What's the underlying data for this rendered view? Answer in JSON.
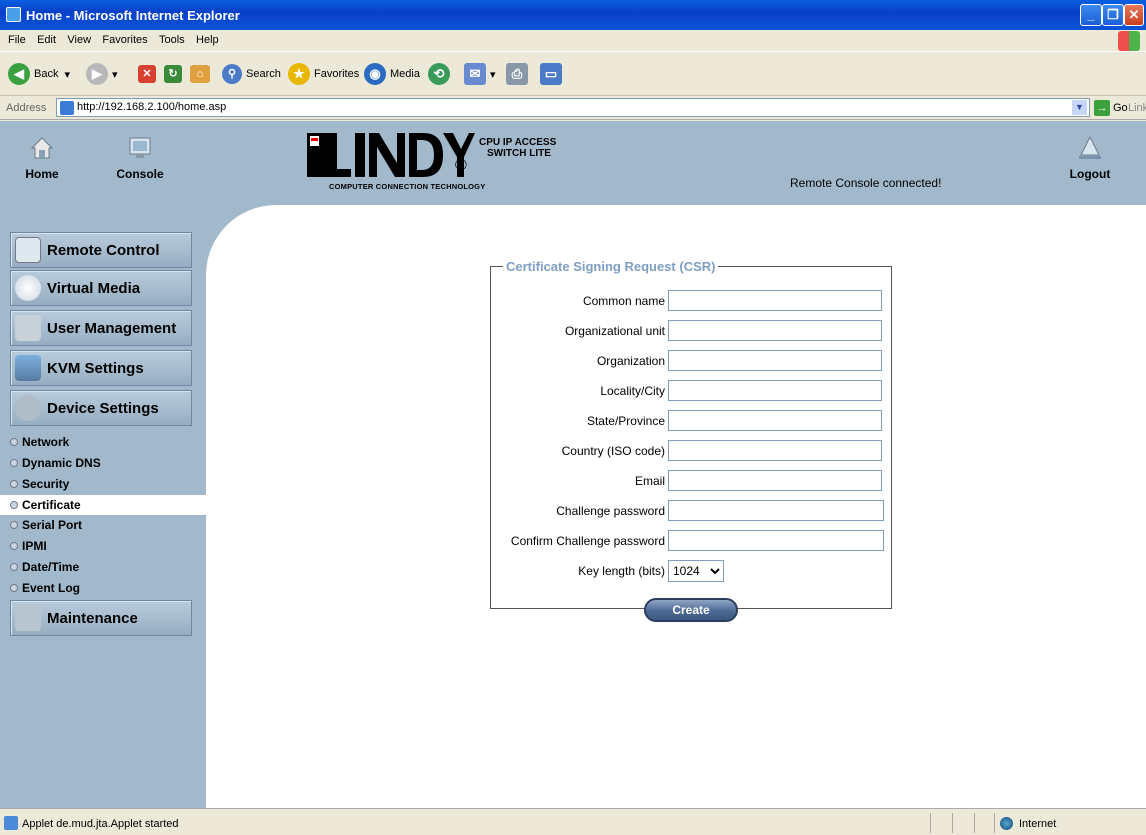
{
  "window": {
    "title": "Home - Microsoft Internet Explorer"
  },
  "menubar": [
    "File",
    "Edit",
    "View",
    "Favorites",
    "Tools",
    "Help"
  ],
  "toolbar": {
    "back": "Back",
    "search": "Search",
    "favorites": "Favorites",
    "media": "Media"
  },
  "address": {
    "label": "Address",
    "url": "http://192.168.2.100/home.asp",
    "go": "Go",
    "links": "Links"
  },
  "header": {
    "home": "Home",
    "console": "Console",
    "logo_text": "LINDY",
    "logo_sub": "COMPUTER CONNECTION TECHNOLOGY",
    "product_line1": "CPU IP ACCESS",
    "product_line2": "SWITCH LITE",
    "status": "Remote Console connected!",
    "logout": "Logout"
  },
  "sidebar": {
    "menus": [
      "Remote Control",
      "Virtual Media",
      "User Management",
      "KVM Settings",
      "Device Settings",
      "Maintenance"
    ],
    "submenu": [
      "Network",
      "Dynamic DNS",
      "Security",
      "Certificate",
      "Serial Port",
      "IPMI",
      "Date/Time",
      "Event Log"
    ],
    "active_submenu": "Certificate"
  },
  "csr": {
    "legend": "Certificate Signing Request (CSR)",
    "fields": [
      "Common name",
      "Organizational unit",
      "Organization",
      "Locality/City",
      "State/Province",
      "Country (ISO code)",
      "Email",
      "Challenge password",
      "Confirm Challenge password"
    ],
    "key_length_label": "Key length (bits)",
    "key_length_value": "1024",
    "create_button": "Create"
  },
  "statusbar": {
    "text": "Applet de.mud.jta.Applet started",
    "zone": "Internet"
  }
}
